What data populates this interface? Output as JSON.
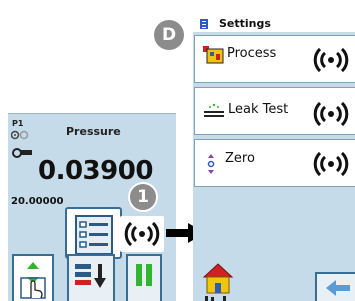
{
  "pressure_screen": {
    "channel_label": "P1",
    "title": "Pressure",
    "reading": "0.03900",
    "range": "20.00000",
    "callout_badge": "1"
  },
  "settings_screen": {
    "callout_badge": "D",
    "title": "Settings",
    "items": [
      {
        "label": "Process",
        "icon": "process-icon",
        "action_icon": "signal-waves-icon"
      },
      {
        "label": "Leak Test",
        "icon": "leak-test-icon",
        "action_icon": "signal-waves-icon"
      },
      {
        "label": "Zero",
        "icon": "zero-icon",
        "action_icon": "signal-waves-icon"
      }
    ]
  },
  "colors": {
    "panel_bg": "#c5dbe9",
    "button_border": "#3a6d93",
    "badge_gray": "#8c8c8c",
    "accent_green": "#2fb52f",
    "accent_red": "#cc2222"
  }
}
